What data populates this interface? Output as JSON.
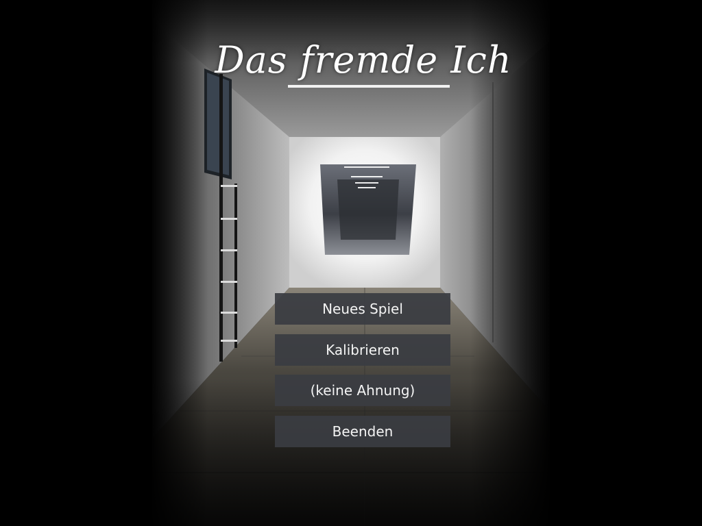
{
  "game": {
    "title": "Das fremde Ich"
  },
  "menu": {
    "items": [
      {
        "label": "Neues Spiel"
      },
      {
        "label": "Kalibrieren"
      },
      {
        "label": "(keine Ahnung)"
      },
      {
        "label": "Beenden"
      }
    ]
  },
  "colors": {
    "background": "#000000",
    "button_fill": "#3a3c42",
    "button_text": "#f4f4f4",
    "title_text": "#ffffff"
  }
}
